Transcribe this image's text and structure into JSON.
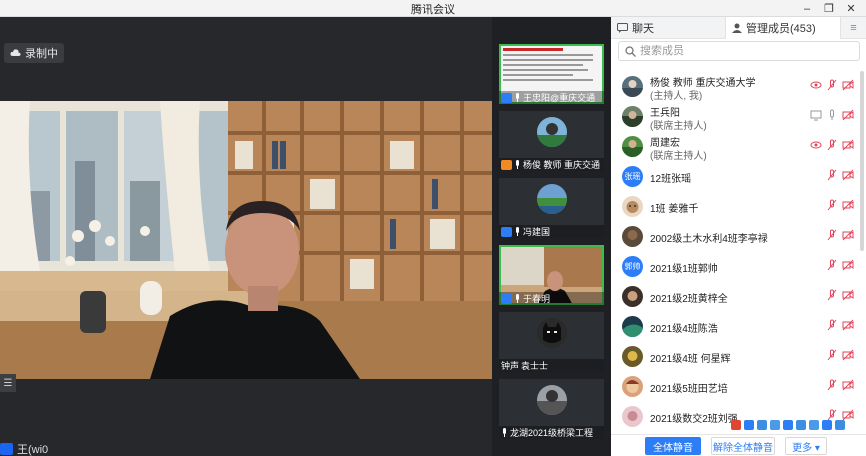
{
  "window": {
    "title": "腾讯会议",
    "controls": [
      "minimize",
      "maximize",
      "close"
    ]
  },
  "main": {
    "recording_label": "录制中",
    "bottom_name": "王(wi0"
  },
  "thumbnails": [
    {
      "name": "王忠阳@重庆交通",
      "kind": "slides",
      "active": true
    },
    {
      "name": "杨俊 教师 重庆交通",
      "kind": "avatar",
      "active": false
    },
    {
      "name": "冯建国",
      "kind": "landscape",
      "active": false
    },
    {
      "name": "于春明",
      "kind": "video",
      "active": true
    },
    {
      "name": "袁士士",
      "kind": "batman",
      "prefix": "钟声",
      "active": false
    },
    {
      "name": "龙湖2021级桥梁工程",
      "kind": "avatar",
      "active": false
    }
  ],
  "panel": {
    "tabs": [
      {
        "label": "聊天",
        "icon": "chat-icon"
      },
      {
        "label": "管理成员(453)",
        "icon": "person-icon"
      },
      {
        "label": "≡",
        "icon": "menu-icon"
      }
    ],
    "search_placeholder": "搜索成员",
    "members": [
      {
        "name": "杨俊 教师 重庆交通大学",
        "role": "(主持人, 我)",
        "avatar": "photo",
        "host_icons": true
      },
      {
        "name": "王兵阳",
        "role": "(联席主持人)",
        "avatar": "photo",
        "cohost_icons": true
      },
      {
        "name": "周建宏",
        "role": "(联席主持人)",
        "avatar": "photo",
        "host_icons": true
      },
      {
        "name": "12班张瑶",
        "avatar_text": "张瑶"
      },
      {
        "name": "1班 姜雅千",
        "avatar": "photo"
      },
      {
        "name": "2002级土木水利4班李亭禄",
        "avatar": "photo"
      },
      {
        "name": "2021级1班郭帅",
        "avatar_text": "郭帅"
      },
      {
        "name": "2021级2班黄梓全",
        "avatar": "photo"
      },
      {
        "name": "2021级4班陈浩",
        "avatar": "photo"
      },
      {
        "name": "2021级4班 何星辉",
        "avatar": "photo"
      },
      {
        "name": "2021级5班田艺培",
        "avatar": "photo"
      },
      {
        "name": "2021级数交2班刘强",
        "avatar": "photo"
      }
    ],
    "footer": {
      "mute_all": "全体静音",
      "unmute_all": "解除全体静音",
      "more": "更多 ▾"
    }
  },
  "colors": {
    "accent": "#2d7df6",
    "active_border": "#3bbd4e",
    "mic_off": "#e0455a"
  }
}
